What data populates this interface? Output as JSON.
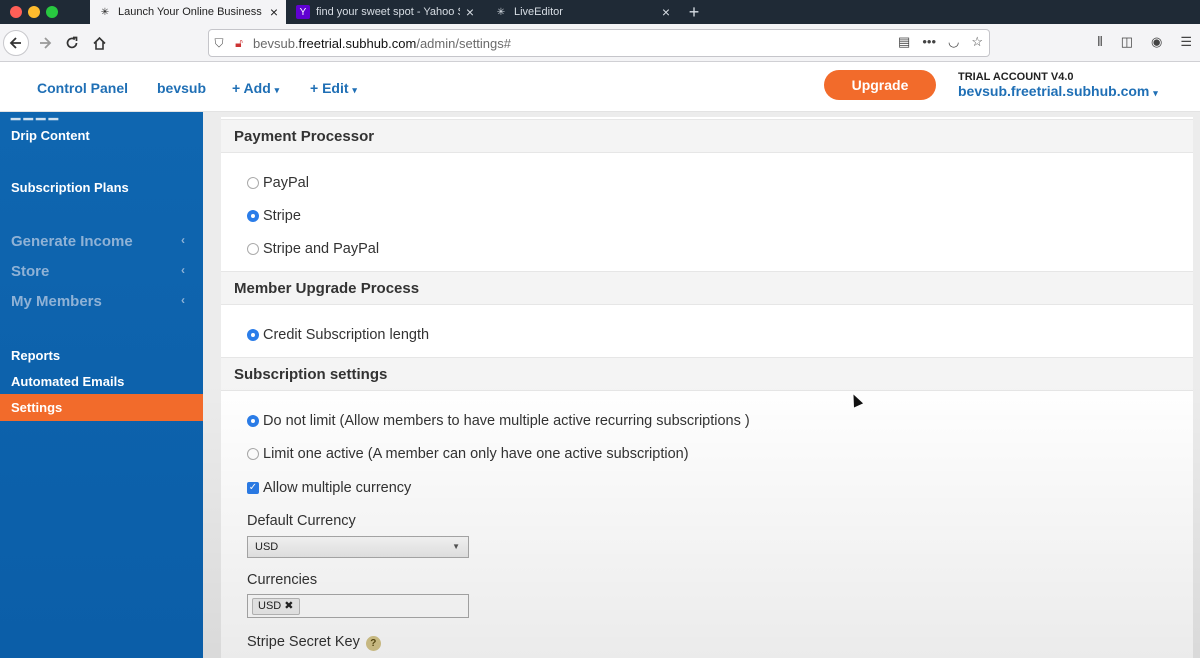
{
  "browser": {
    "tabs": [
      {
        "title": "Launch Your Online Business",
        "active": true
      },
      {
        "title": "find your sweet spot - Yahoo Se",
        "active": false
      },
      {
        "title": "LiveEditor",
        "active": false
      }
    ],
    "url_prefix": "bevsub.",
    "url_domain": "freetrial.subhub.com",
    "url_path": "/admin/settings#",
    "more_label": "•••"
  },
  "header": {
    "nav": [
      "Control Panel",
      "bevsub",
      "+ Add",
      "+ Edit"
    ],
    "upgrade_label": "Upgrade",
    "account_type": "TRIAL ACCOUNT V4.0",
    "account_domain": "bevsub.freetrial.subhub.com"
  },
  "sidebar": {
    "items": [
      {
        "label": "Drip Content"
      },
      {
        "label": "Subscription Plans"
      },
      {
        "label": "Generate Income"
      },
      {
        "label": "Store"
      },
      {
        "label": "My Members"
      },
      {
        "label": "Reports"
      },
      {
        "label": "Automated Emails"
      },
      {
        "label": "Settings"
      }
    ]
  },
  "main": {
    "payment": {
      "heading": "Payment Processor",
      "options": [
        "PayPal",
        "Stripe",
        "Stripe and PayPal"
      ],
      "selected": "Stripe"
    },
    "upgrade_process": {
      "heading": "Member Upgrade Process",
      "options": [
        "Credit Subscription length"
      ],
      "selected": "Credit Subscription length"
    },
    "subscription": {
      "heading": "Subscription settings",
      "options": [
        "Do not limit (Allow members to have multiple active recurring subscriptions )",
        "Limit one active (A member can only have one active subscription)"
      ],
      "selected": "Do not limit (Allow members to have multiple active recurring subscriptions )",
      "allow_multiple_currency_label": "Allow multiple currency",
      "allow_multiple_currency": true,
      "default_currency_label": "Default Currency",
      "default_currency": "USD",
      "currencies_label": "Currencies",
      "currencies": [
        "USD"
      ],
      "stripe_secret_label": "Stripe Secret Key",
      "help_glyph": "?"
    }
  },
  "colors": {
    "accent": "#f26b2b",
    "brand_blue": "#1f6fb5",
    "sidebar": "#0f66b0"
  }
}
